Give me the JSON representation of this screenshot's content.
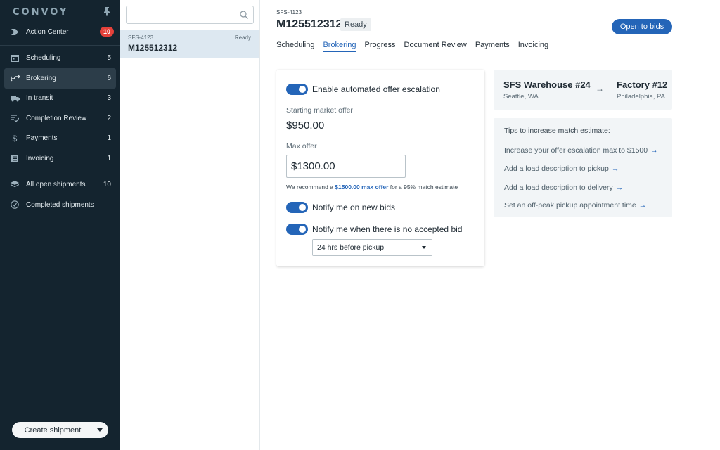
{
  "app": {
    "brand": "CONVOY"
  },
  "sidebar": {
    "items": [
      {
        "label": "Action Center",
        "badge": "10",
        "icon": "action-center-icon"
      },
      {
        "label": "Scheduling",
        "count": "5",
        "icon": "calendar-icon"
      },
      {
        "label": "Brokering",
        "count": "6",
        "icon": "brokering-icon",
        "active": true
      },
      {
        "label": "In transit",
        "count": "3",
        "icon": "truck-icon"
      },
      {
        "label": "Completion Review",
        "count": "2",
        "icon": "review-icon"
      },
      {
        "label": "Payments",
        "count": "1",
        "icon": "dollar-icon"
      },
      {
        "label": "Invoicing",
        "count": "1",
        "icon": "invoice-icon"
      }
    ],
    "secondary": [
      {
        "label": "All open shipments",
        "count": "10",
        "icon": "layers-icon"
      },
      {
        "label": "Completed shipments",
        "count": "",
        "icon": "check-circle-icon"
      }
    ],
    "create_label": "Create shipment"
  },
  "list": {
    "search_placeholder": "",
    "item": {
      "id": "SFS-4123",
      "status": "Ready",
      "title": "M125512312"
    }
  },
  "shipment": {
    "sub_id": "SFS-4123",
    "title": "M125512312",
    "status": "Ready",
    "open_bids_label": "Open to bids",
    "tabs": [
      "Scheduling",
      "Brokering",
      "Progress",
      "Document Review",
      "Payments",
      "Invoicing"
    ],
    "active_tab": "Brokering"
  },
  "brokering": {
    "escalation_label": "Enable automated offer escalation",
    "escalation_on": true,
    "starting_label": "Starting market offer",
    "starting_value": "$950.00",
    "max_label": "Max offer",
    "max_value": "$1300.00",
    "recommend_prefix": "We recommend a ",
    "recommend_link": "$1500.00 max offer",
    "recommend_suffix": " for a 95% match estimate",
    "notify_bids_label": "Notify me on new bids",
    "notify_bids_on": true,
    "notify_noaccept_label": "Notify me when there is no accepted bid",
    "notify_noaccept_on": true,
    "notify_timing": "24 hrs before pickup"
  },
  "route": {
    "from_name": "SFS Warehouse #24",
    "from_city": "Seattle, WA",
    "to_name": "Factory #12",
    "to_city": "Philadelphia, PA",
    "arrow": "→"
  },
  "tips": {
    "title": "Tips to increase match estimate:",
    "items": [
      "Increase your offer escalation max to $1500",
      "Add a load description to pickup",
      "Add a load description to delivery",
      "Set an off-peak pickup appointment time"
    ],
    "arrow": "→"
  },
  "colors": {
    "accent": "#2465b8",
    "sidebar_bg": "#14242f",
    "badge": "#e5413a",
    "selected_row": "#dde8f1"
  }
}
